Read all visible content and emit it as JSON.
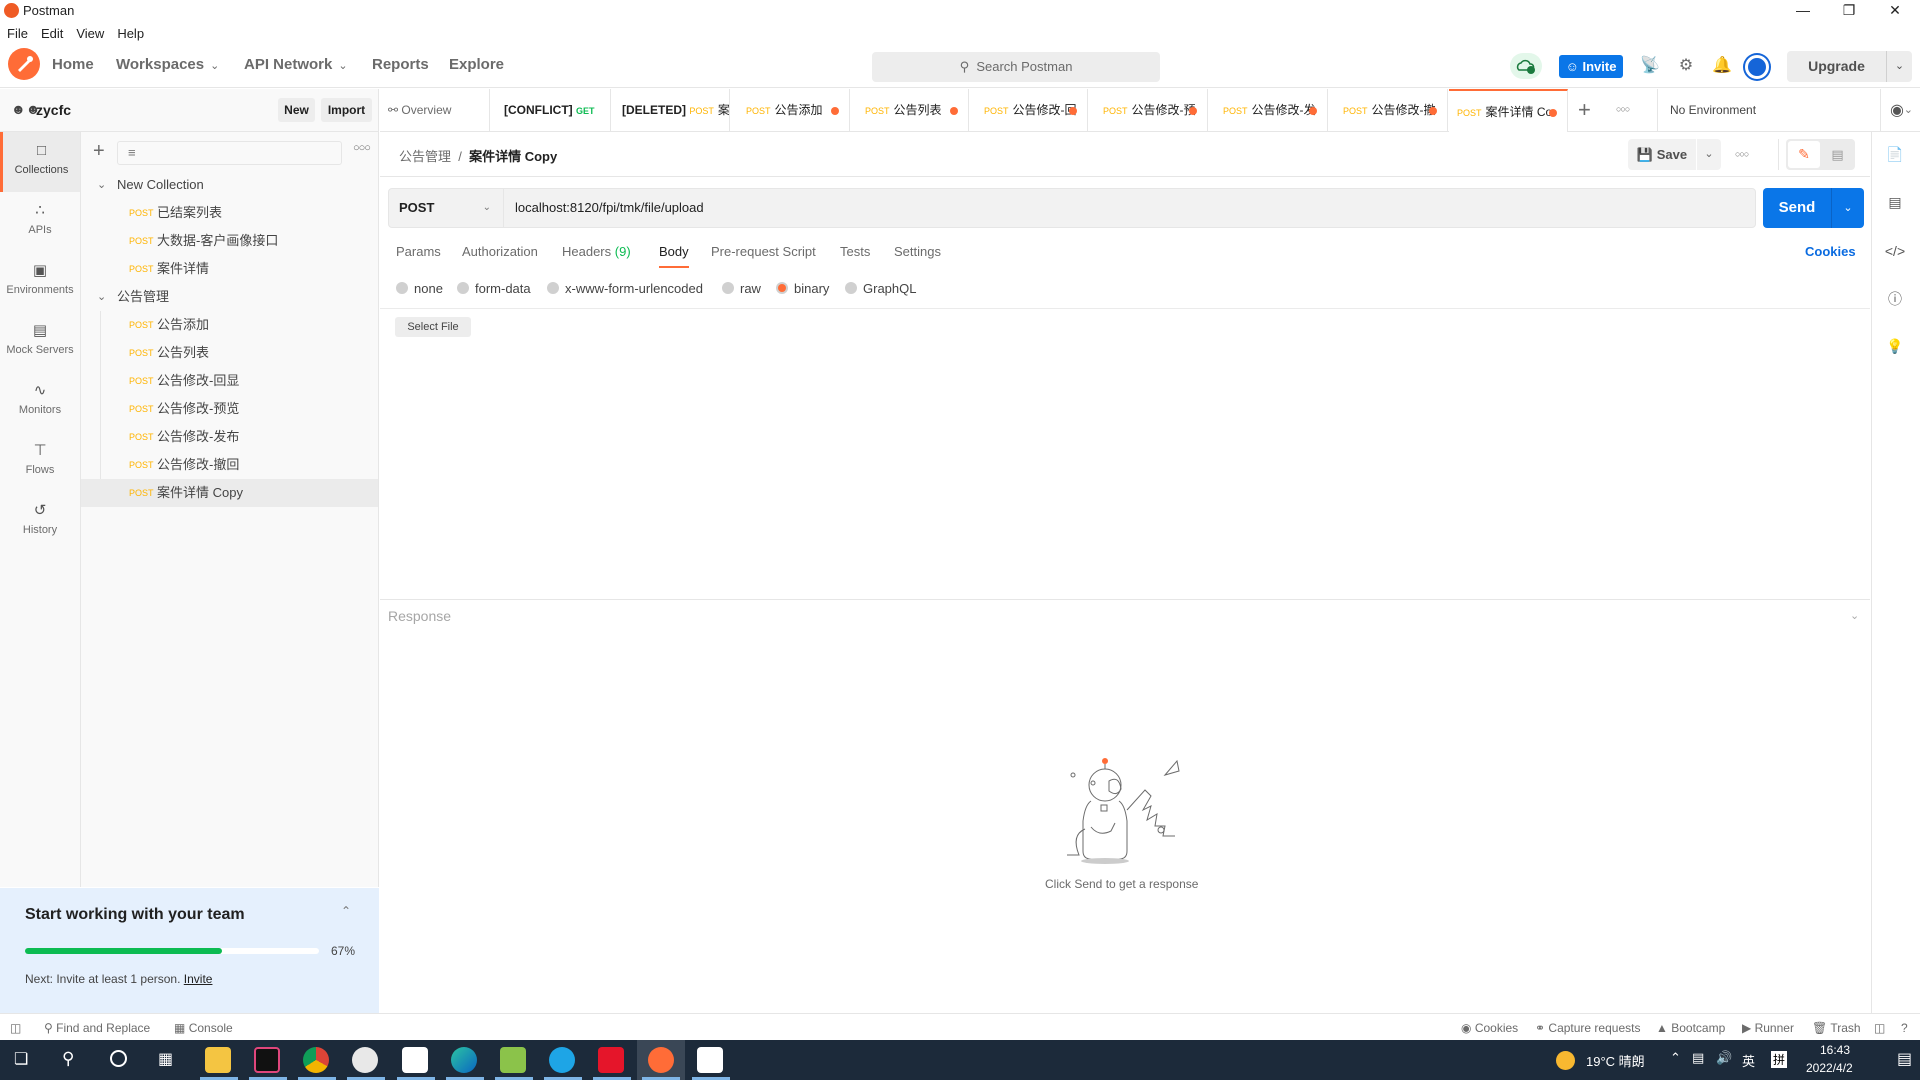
{
  "window": {
    "title": "Postman",
    "controls": [
      "minimize",
      "restore",
      "close"
    ]
  },
  "menu": [
    "File",
    "Edit",
    "View",
    "Help"
  ],
  "header": {
    "nav": [
      {
        "label": "Home",
        "dropdown": false
      },
      {
        "label": "Workspaces",
        "dropdown": true
      },
      {
        "label": "API Network",
        "dropdown": true
      },
      {
        "label": "Reports",
        "dropdown": false
      },
      {
        "label": "Explore",
        "dropdown": false
      }
    ],
    "search_placeholder": "Search Postman",
    "invite_label": "Invite",
    "upgrade_label": "Upgrade",
    "icons": [
      "cloud-sync-icon",
      "satellite-icon",
      "settings-icon",
      "bell-icon",
      "avatar"
    ]
  },
  "workspace": {
    "name": "zycfc",
    "new_label": "New",
    "import_label": "Import"
  },
  "rail": [
    {
      "label": "Collections",
      "icon": "collections-icon",
      "active": true
    },
    {
      "label": "APIs",
      "icon": "apis-icon",
      "active": false
    },
    {
      "label": "Environments",
      "icon": "environments-icon",
      "active": false
    },
    {
      "label": "Mock Servers",
      "icon": "mock-servers-icon",
      "active": false
    },
    {
      "label": "Monitors",
      "icon": "monitors-icon",
      "active": false
    },
    {
      "label": "Flows",
      "icon": "flows-icon",
      "active": false
    },
    {
      "label": "History",
      "icon": "history-icon",
      "active": false
    }
  ],
  "collections": [
    {
      "name": "New Collection",
      "expanded": true,
      "requests": [
        {
          "method": "POST",
          "name": "已结案列表"
        },
        {
          "method": "POST",
          "name": "大数据-客户画像接口"
        },
        {
          "method": "POST",
          "name": "案件详情"
        }
      ]
    },
    {
      "name": "公告管理",
      "expanded": true,
      "requests": [
        {
          "method": "POST",
          "name": "公告添加"
        },
        {
          "method": "POST",
          "name": "公告列表"
        },
        {
          "method": "POST",
          "name": "公告修改-回显"
        },
        {
          "method": "POST",
          "name": "公告修改-预览"
        },
        {
          "method": "POST",
          "name": "公告修改-发布"
        },
        {
          "method": "POST",
          "name": "公告修改-撤回"
        },
        {
          "method": "POST",
          "name": "案件详情 Copy",
          "selected": true
        }
      ]
    }
  ],
  "onboarding": {
    "title": "Start working with your team",
    "progress_percent": 67,
    "progress_label": "67%",
    "next_text": "Next: Invite at least 1 person.",
    "next_link": "Invite"
  },
  "tabs": [
    {
      "prefix": "",
      "method": "",
      "label": "Overview",
      "icon": "overview-icon"
    },
    {
      "prefix": "[CONFLICT]",
      "method": "GET",
      "label": ""
    },
    {
      "prefix": "[DELETED]",
      "method": "POST",
      "label": "案件"
    },
    {
      "prefix": "",
      "method": "POST",
      "label": "公告添加",
      "unsaved": true
    },
    {
      "prefix": "",
      "method": "POST",
      "label": "公告列表",
      "unsaved": true
    },
    {
      "prefix": "",
      "method": "POST",
      "label": "公告修改-回",
      "unsaved": true
    },
    {
      "prefix": "",
      "method": "POST",
      "label": "公告修改-预",
      "unsaved": true
    },
    {
      "prefix": "",
      "method": "POST",
      "label": "公告修改-发",
      "unsaved": true
    },
    {
      "prefix": "",
      "method": "POST",
      "label": "公告修改-撤",
      "unsaved": true
    },
    {
      "prefix": "",
      "method": "POST",
      "label": "案件详情 Co",
      "unsaved": true,
      "active": true
    }
  ],
  "environment": {
    "selected": "No Environment"
  },
  "request": {
    "breadcrumb_parent": "公告管理",
    "breadcrumb_current": "案件详情 Copy",
    "save_label": "Save",
    "method": "POST",
    "url": "localhost:8120/fpi/tmk/file/upload",
    "send_label": "Send",
    "tabs": [
      {
        "label": "Params"
      },
      {
        "label": "Authorization"
      },
      {
        "label": "Headers",
        "count": "(9)"
      },
      {
        "label": "Body",
        "active": true
      },
      {
        "label": "Pre-request Script"
      },
      {
        "label": "Tests"
      },
      {
        "label": "Settings"
      }
    ],
    "cookies_label": "Cookies",
    "body_modes": [
      "none",
      "form-data",
      "x-www-form-urlencoded",
      "raw",
      "binary",
      "GraphQL"
    ],
    "body_mode_selected": "binary",
    "select_file_label": "Select File"
  },
  "response": {
    "title": "Response",
    "empty_text": "Click Send to get a response"
  },
  "statusbar": {
    "left": [
      "Find and Replace",
      "Console"
    ],
    "right": [
      "Cookies",
      "Capture requests",
      "Bootcamp",
      "Runner",
      "Trash"
    ]
  },
  "taskbar": {
    "apps": [
      "File Explorer",
      "IntelliJ IDEA",
      "Chrome",
      "App",
      "App",
      "Edge",
      "Notepad",
      "Internet Explorer",
      "Youdao",
      "Postman",
      "App"
    ],
    "weather": "19°C 晴朗",
    "ime": "英",
    "ime2": "拼",
    "time": "16:43",
    "date": "2022/4/2"
  }
}
